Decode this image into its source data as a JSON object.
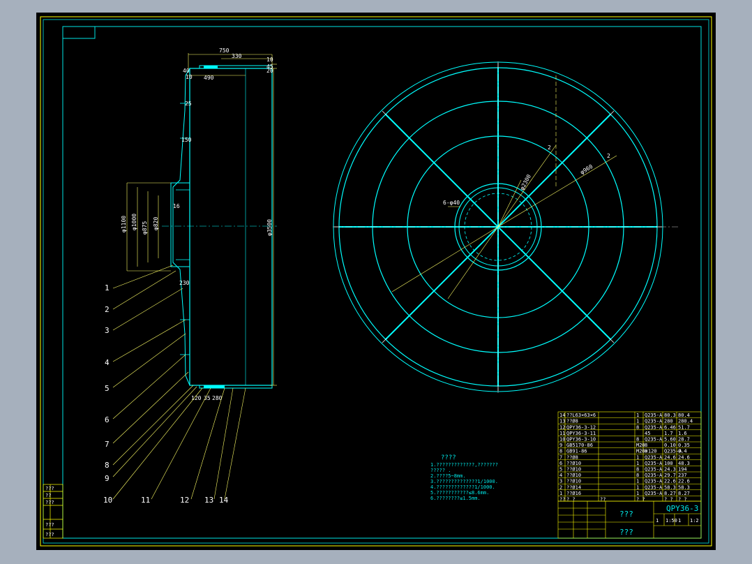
{
  "colors": {
    "outer_frame": "#ffff00",
    "inner_frame": "#00e5e5",
    "geometry": "#00ffff",
    "dimension": "#ffff66",
    "text": "#ffffff"
  },
  "side_view": {
    "dims_top": [
      "750",
      "330",
      "10",
      "40",
      "10",
      "490",
      "45",
      "20"
    ],
    "dims_left": [
      "φ1100",
      "φ1000",
      "φ875",
      "φ820",
      "16",
      "25",
      "150",
      "230"
    ],
    "dim_height": "φ3500",
    "dims_bottom": [
      "120",
      "35",
      "280"
    ]
  },
  "leaders": [
    "1",
    "2",
    "3",
    "4",
    "5",
    "6",
    "7",
    "8",
    "9",
    "10",
    "11",
    "12",
    "13",
    "14"
  ],
  "front_view": {
    "dim_labels": [
      "φ2300",
      "φ960",
      "6-φ40",
      "2",
      "2",
      "φ3500"
    ]
  },
  "notes": {
    "title": "????",
    "lines": [
      "1.?????????????,???????",
      "????? .",
      "2.????5~8mm.",
      "3.??????????????1/1000.",
      "4.?????????????1/1000.",
      "5.???????????≤8.6mm.",
      "6.????????≤1.5mm."
    ]
  },
  "parts_list": {
    "rows": [
      [
        "14",
        "??L63×63×6",
        "1",
        "Q235-A",
        "80.3",
        "80.4"
      ],
      [
        "13",
        "??Ø8",
        "1",
        "Q235-A",
        "280",
        "280.4"
      ],
      [
        "12",
        "QPY36-3-12",
        "8",
        "Q235-A",
        "6.46",
        "51.7"
      ],
      [
        "11",
        "QPY36-3-11",
        "",
        "45",
        "1.7",
        "1.6"
      ],
      [
        "10",
        "QPY36-3-10",
        "8",
        "Q235-A",
        "5.60",
        "28.7"
      ],
      [
        "9",
        "GB5170-86",
        "M20",
        "8",
        "0.10",
        "0.35"
      ],
      [
        "8",
        "GB91-86",
        "M20×120",
        "8",
        "Q235-A",
        "0.4"
      ],
      [
        "7",
        "??Ø8",
        "1",
        "Q235-A",
        "24.6",
        "24.6"
      ],
      [
        "6",
        "??Ø10",
        "1",
        "Q235-A",
        "100",
        "48.3"
      ],
      [
        "5",
        "??Ø10",
        "8",
        "Q235-A",
        "24.3",
        "194"
      ],
      [
        "4",
        "??Ø10",
        "8",
        "Q235-A",
        "29.7",
        "237"
      ],
      [
        "3",
        "??Ø10",
        "1",
        "Q235-A",
        "22.6",
        "22.6"
      ],
      [
        "2",
        "??Ø14",
        "1",
        "Q235-A",
        "58.3",
        "58.3"
      ],
      [
        "1",
        "??Ø16",
        "1",
        "Q235-A",
        "8.27",
        "8.27"
      ]
    ],
    "header": [
      "??",
      "? ?",
      "??",
      "? ?",
      "? ?",
      "? ?"
    ]
  },
  "title_block": {
    "drawing_no": "QPY36-3",
    "name": "???",
    "company": "???",
    "scale_cells": [
      "1",
      "1:50",
      "1",
      "1:2"
    ]
  },
  "side_cells": [
    "???",
    "??",
    "???",
    "???",
    "???"
  ]
}
